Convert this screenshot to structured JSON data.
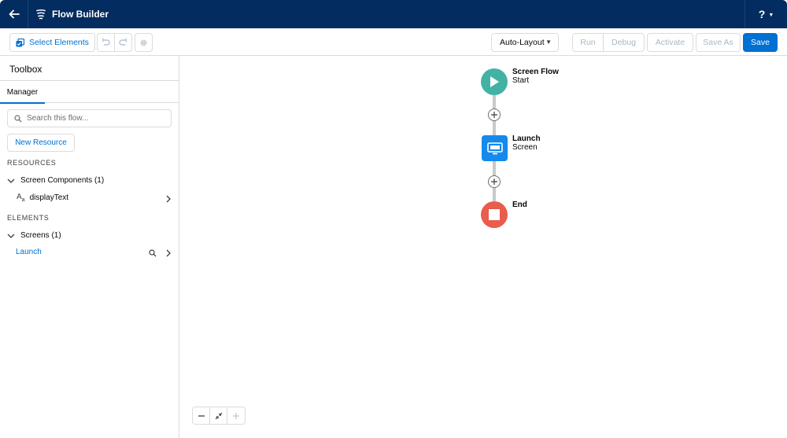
{
  "header": {
    "app_title": "Flow Builder",
    "help_label": "?",
    "back_icon": "arrow-left-icon",
    "app_icon": "flow-icon"
  },
  "toolbar": {
    "select_elements": "Select Elements",
    "layout_value": "Auto-Layout",
    "run": "Run",
    "debug": "Debug",
    "activate": "Activate",
    "save_as": "Save As",
    "save": "Save"
  },
  "sidebar": {
    "title": "Toolbox",
    "tabs": [
      {
        "label": "Manager",
        "active": true
      }
    ],
    "search_placeholder": "Search this flow...",
    "new_resource": "New Resource",
    "resources_heading": "RESOURCES",
    "resource_groups": [
      {
        "label": "Screen Components (1)",
        "items": [
          {
            "label": "displayText",
            "icon": "text-template-icon"
          }
        ]
      }
    ],
    "elements_heading": "ELEMENTS",
    "element_groups": [
      {
        "label": "Screens (1)",
        "items": [
          {
            "label": "Launch"
          }
        ]
      }
    ]
  },
  "canvas": {
    "nodes": [
      {
        "title": "Screen Flow",
        "subtitle": "Start",
        "type": "start"
      },
      {
        "title": "Launch",
        "subtitle": "Screen",
        "type": "screen"
      },
      {
        "title": "End",
        "subtitle": "",
        "type": "end"
      }
    ],
    "zoom_controls": [
      "zoom-out",
      "fit-to-view",
      "zoom-in"
    ]
  },
  "colors": {
    "header_bg": "#032d60",
    "brand": "#0070d2",
    "start_node": "#42b2a5",
    "screen_node": "#1589ee",
    "end_node": "#ea5c4c"
  }
}
